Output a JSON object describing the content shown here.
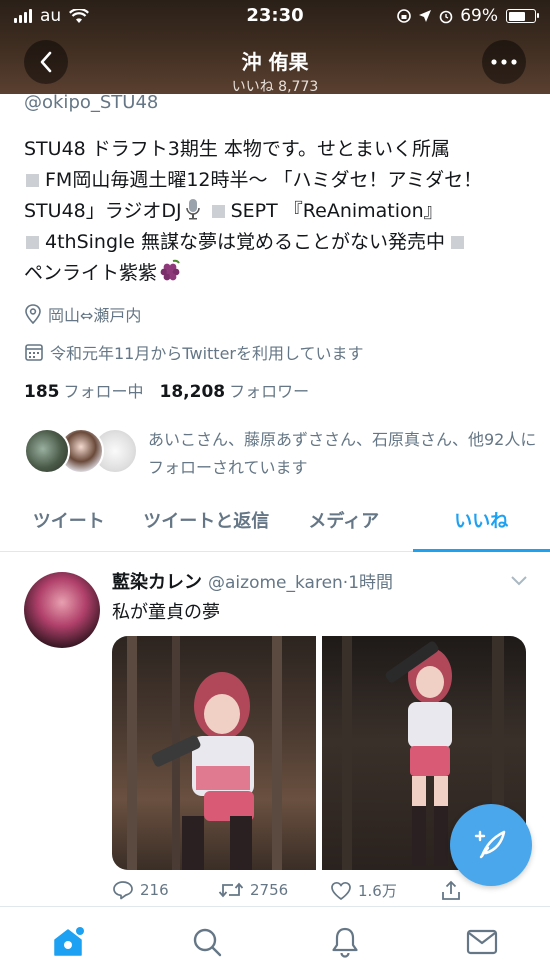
{
  "status_bar": {
    "carrier": "au",
    "time": "23:30",
    "battery_percent_text": "69%",
    "battery_level": 0.69
  },
  "nav": {
    "title": "沖 侑果",
    "likes_subtitle": "いいね 8,773"
  },
  "profile": {
    "handle": "@okipo_STU48",
    "bio": {
      "line1": "STU48 ドラフト3期生 本物です。せとまいく所属",
      "line2": "FM岡山毎週土曜12時半〜 「ハミダセ！アミダセ！",
      "line3a": "STU48」ラジオDJ",
      "line3b": "SEPT 『ReAnimation』",
      "line4": "4thSingle 無謀な夢は覚めることがない発売中",
      "line5": "ペンライト紫紫"
    },
    "location": "岡山⇔瀬戸内",
    "joined": "令和元年11月からTwitterを利用しています",
    "following_count": "185",
    "following_label": "フォロー中",
    "followers_count": "18,208",
    "followers_label": "フォロワー",
    "known_followers_text": "あいこさん、藤原あずささん、石原真さん、他92人にフォローされています"
  },
  "tabs": [
    {
      "label": "ツイート"
    },
    {
      "label": "ツイートと返信"
    },
    {
      "label": "メディア"
    },
    {
      "label": "いいね"
    }
  ],
  "tweet": {
    "author_name": "藍染カレン",
    "author_handle": "@aizome_karen",
    "time": "·1時間",
    "text": "私が童貞の夢",
    "replies": "216",
    "retweets": "2756",
    "likes": "1.6万"
  },
  "icons": {
    "back": "chevron-left-icon",
    "more": "more-icon",
    "location": "location-pin-icon",
    "calendar": "calendar-icon",
    "compose": "compose-feather-icon",
    "home": "home-icon",
    "search": "search-icon",
    "notifications": "bell-icon",
    "messages": "mail-icon"
  },
  "colors": {
    "accent": "#1da1f2",
    "secondary_text": "#657786",
    "fab": "#4aa7ec"
  }
}
